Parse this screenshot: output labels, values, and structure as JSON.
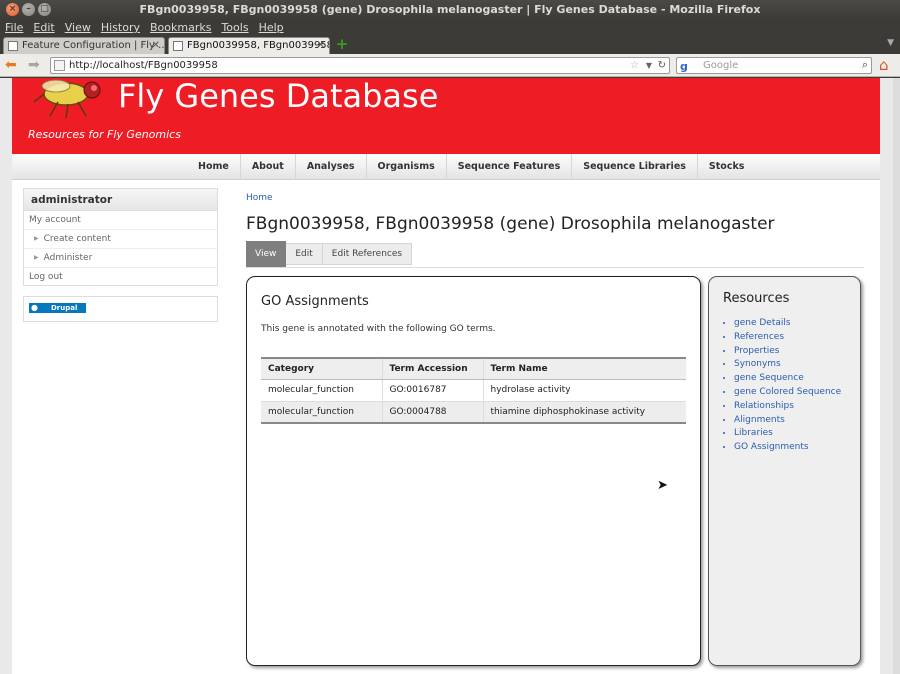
{
  "window": {
    "title": "FBgn0039958, FBgn0039958 (gene) Drosophila melanogaster | Fly Genes Database - Mozilla Firefox"
  },
  "menubar": [
    "File",
    "Edit",
    "View",
    "History",
    "Bookmarks",
    "Tools",
    "Help"
  ],
  "tabs": [
    {
      "label": "Feature Configuration | Fly ..."
    },
    {
      "label": "FBgn0039958, FBgn0039958..."
    }
  ],
  "navbar": {
    "url": "http://localhost/FBgn0039958",
    "search_placeholder": "Google"
  },
  "site": {
    "name": "Fly Genes Database",
    "slogan": "Resources for Fly Genomics"
  },
  "primary_nav": [
    "Home",
    "About",
    "Analyses",
    "Organisms",
    "Sequence Features",
    "Sequence Libraries",
    "Stocks"
  ],
  "user_block": {
    "title": "administrator",
    "items": [
      {
        "label": "My account"
      },
      {
        "label": "Create content"
      },
      {
        "label": "Administer"
      },
      {
        "label": "Log out"
      }
    ]
  },
  "drupal_badge": "Drupal",
  "breadcrumb": "Home",
  "page_title": "FBgn0039958, FBgn0039958 (gene) Drosophila melanogaster",
  "page_tabs": [
    "View",
    "Edit",
    "Edit References"
  ],
  "go": {
    "heading": "GO Assignments",
    "intro": "This gene is annotated with the following GO terms.",
    "columns": [
      "Category",
      "Term Accession",
      "Term Name"
    ],
    "rows": [
      [
        "molecular_function",
        "GO:0016787",
        "hydrolase activity"
      ],
      [
        "molecular_function",
        "GO:0004788",
        "thiamine diphosphokinase activity"
      ]
    ]
  },
  "resources": {
    "heading": "Resources",
    "links": [
      "gene Details",
      "References",
      "Properties",
      "Synonyms",
      "gene Sequence",
      "gene Colored Sequence",
      "Relationships",
      "Alignments",
      "Libraries",
      "GO Assignments"
    ]
  },
  "colors": {
    "header": "#ee1c24",
    "link": "#2a5db0",
    "active_tab": "#7f7f7f"
  }
}
